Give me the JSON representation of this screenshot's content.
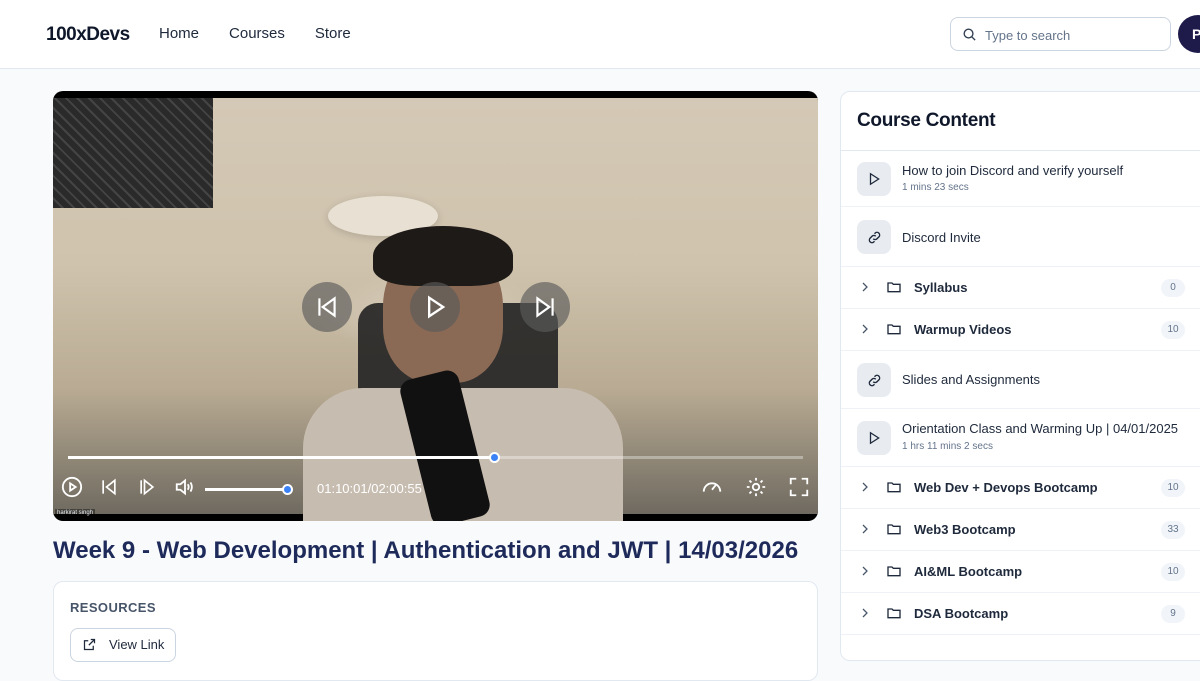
{
  "header": {
    "logo": "100xDevs",
    "nav": [
      "Home",
      "Courses",
      "Store"
    ],
    "search_placeholder": "Type to search",
    "avatar_initial": "P"
  },
  "video": {
    "progress_fraction": 0.58,
    "volume_fraction": 1.0,
    "time_display": "01:10:01/02:00:55",
    "watermark": "harkirat singh"
  },
  "lecture": {
    "title": "Week 9 - Web Development | Authentication and JWT | 14/03/2026"
  },
  "resources": {
    "label": "RESOURCES",
    "link_label": "View Link"
  },
  "course_content": {
    "title": "Course Content",
    "items": [
      {
        "type": "video",
        "title": "How to join Discord and verify yourself",
        "duration": "1 mins 23 secs"
      },
      {
        "type": "link",
        "title": "Discord Invite"
      },
      {
        "type": "folder",
        "title": "Syllabus",
        "count": "0"
      },
      {
        "type": "folder",
        "title": "Warmup Videos",
        "count": "10"
      },
      {
        "type": "link",
        "title": "Slides and Assignments"
      },
      {
        "type": "video",
        "title": "Orientation Class and Warming Up | 04/01/2025",
        "duration": "1 hrs 11 mins 2 secs"
      },
      {
        "type": "folder",
        "title": "Web Dev + Devops Bootcamp",
        "count": "10"
      },
      {
        "type": "folder",
        "title": "Web3 Bootcamp",
        "count": "33"
      },
      {
        "type": "folder",
        "title": "AI&ML Bootcamp",
        "count": "10"
      },
      {
        "type": "folder",
        "title": "DSA Bootcamp",
        "count": "9"
      }
    ]
  },
  "colors": {
    "accent": "#3b82f6",
    "title_navy": "#1e2a5a",
    "avatar_bg": "#1e1b4b"
  }
}
